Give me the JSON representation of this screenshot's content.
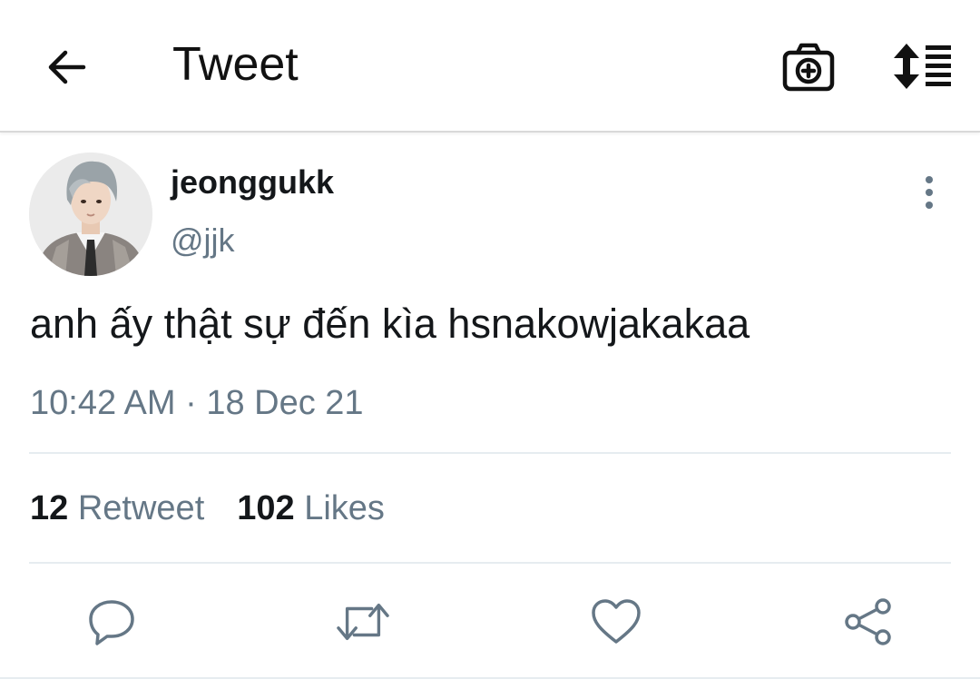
{
  "header": {
    "title": "Tweet",
    "back_icon": "arrow-left-icon",
    "camera_icon": "camera-plus-icon",
    "sort_icon": "sort-list-icon"
  },
  "tweet": {
    "display_name": "jeonggukk",
    "handle": "@jjk",
    "text": "anh ấy thật sự đến kìa hsnakowjakakaa",
    "timestamp": "10:42 AM · 18 Dec 21",
    "stats": {
      "retweet_count": "12",
      "retweet_label": "Retweet",
      "likes_count": "102",
      "likes_label": "Likes"
    }
  },
  "actions": {
    "reply_icon": "reply-icon",
    "retweet_icon": "retweet-icon",
    "like_icon": "heart-icon",
    "share_icon": "share-icon"
  },
  "colors": {
    "primary_text": "#14171a",
    "secondary_text": "#657786",
    "divider": "#e6ecf0",
    "icon_gray": "#657786"
  }
}
